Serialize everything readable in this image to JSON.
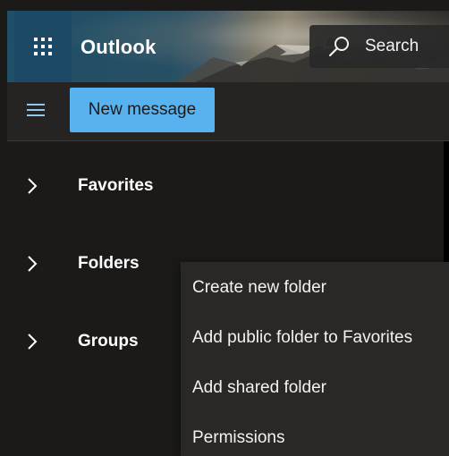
{
  "header": {
    "app_title": "Outlook",
    "search_label": "Search",
    "brand_color": "#1c4a66"
  },
  "command_bar": {
    "new_message_label": "New message",
    "new_message_color": "#58b2f0"
  },
  "nav": {
    "items": [
      {
        "label": "Favorites",
        "icon": "chevron-right-icon"
      },
      {
        "label": "Folders",
        "icon": "chevron-right-icon"
      },
      {
        "label": "Groups",
        "icon": "chevron-right-icon"
      }
    ]
  },
  "context_menu": {
    "items": [
      {
        "label": "Create new folder"
      },
      {
        "label": "Add public folder to Favorites"
      },
      {
        "label": "Add shared folder"
      },
      {
        "label": "Permissions"
      }
    ]
  }
}
